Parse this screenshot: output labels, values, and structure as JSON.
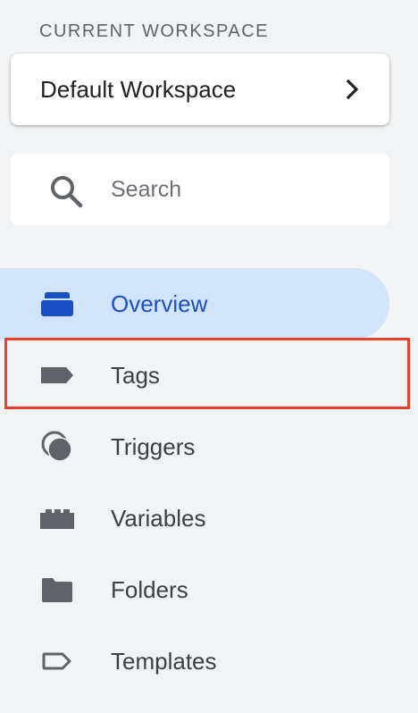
{
  "workspace": {
    "section_label": "CURRENT WORKSPACE",
    "name": "Default Workspace"
  },
  "search": {
    "placeholder": "Search"
  },
  "nav": {
    "items": [
      {
        "label": "Overview",
        "icon": "overview-icon",
        "active": true
      },
      {
        "label": "Tags",
        "icon": "tag-icon",
        "active": false
      },
      {
        "label": "Triggers",
        "icon": "trigger-icon",
        "active": false
      },
      {
        "label": "Variables",
        "icon": "variables-icon",
        "active": false
      },
      {
        "label": "Folders",
        "icon": "folder-icon",
        "active": false
      },
      {
        "label": "Templates",
        "icon": "template-icon",
        "active": false
      }
    ]
  },
  "colors": {
    "active_bg": "#d2e3fc",
    "active_text": "#1a4fc4",
    "highlight_border": "#e8402a"
  }
}
